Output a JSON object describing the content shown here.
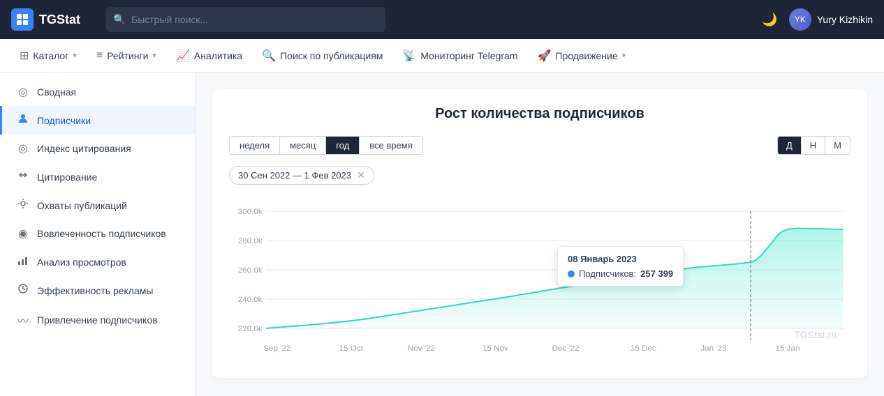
{
  "app": {
    "title": "TGStat",
    "logo_text": "TGStat"
  },
  "top_nav": {
    "search_placeholder": "Быстрый поиск...",
    "user_name": "Yury Kizhikin",
    "moon_icon": "🌙"
  },
  "sec_nav": {
    "items": [
      {
        "id": "catalog",
        "icon": "⊞",
        "label": "Каталог",
        "has_arrow": true
      },
      {
        "id": "ratings",
        "icon": "📊",
        "label": "Рейтинги",
        "has_arrow": true
      },
      {
        "id": "analytics",
        "icon": "📈",
        "label": "Аналитика",
        "has_arrow": false
      },
      {
        "id": "search-pub",
        "icon": "🔍",
        "label": "Поиск по публикациям",
        "has_arrow": false
      },
      {
        "id": "monitoring",
        "icon": "📡",
        "label": "Мониторинг Telegram",
        "has_arrow": false
      },
      {
        "id": "promotion",
        "icon": "🚀",
        "label": "Продвижение",
        "has_arrow": true
      }
    ]
  },
  "sidebar": {
    "items": [
      {
        "id": "summary",
        "icon": "◎",
        "label": "Сводная",
        "active": false
      },
      {
        "id": "subscribers",
        "icon": "👤",
        "label": "Подписчики",
        "active": true
      },
      {
        "id": "citation-index",
        "icon": "◎",
        "label": "Индекс цитирования",
        "active": false
      },
      {
        "id": "citation",
        "icon": "🔁",
        "label": "Цитирование",
        "active": false
      },
      {
        "id": "reach",
        "icon": "👁",
        "label": "Охваты публикаций",
        "active": false
      },
      {
        "id": "engagement",
        "icon": "◎",
        "label": "Вовлеченность подписчиков",
        "active": false
      },
      {
        "id": "views",
        "icon": "📊",
        "label": "Анализ просмотров",
        "active": false
      },
      {
        "id": "ad-efficiency",
        "icon": "◎",
        "label": "Эффективность рекламы",
        "active": false
      },
      {
        "id": "attraction",
        "icon": "〰",
        "label": "Привлечение подписчиков",
        "active": false
      }
    ]
  },
  "chart": {
    "title": "Рост количества подписчиков",
    "period_tabs": [
      {
        "id": "week",
        "label": "неделя",
        "active": false
      },
      {
        "id": "month",
        "label": "месяц",
        "active": false
      },
      {
        "id": "year",
        "label": "год",
        "active": true
      },
      {
        "id": "all",
        "label": "все время",
        "active": false
      }
    ],
    "granularity_tabs": [
      {
        "id": "day",
        "label": "Д",
        "active": true
      },
      {
        "id": "week",
        "label": "Н",
        "active": false
      },
      {
        "id": "month",
        "label": "М",
        "active": false
      }
    ],
    "date_range": "30 Сен 2022 — 1 Фев 2023",
    "y_labels": [
      "300.0k",
      "280.0k",
      "260.0k",
      "240.0k",
      "220.0k"
    ],
    "x_labels": [
      "Sep '22",
      "15 Oct",
      "Nov '22",
      "15 Nov",
      "Dec '22",
      "15 Dec",
      "Jan '23",
      "15 Jan"
    ],
    "tooltip": {
      "date": "08 Январь 2023",
      "label": "Подписчиков:",
      "value": "257 399"
    },
    "watermark": "TGStat.ru"
  }
}
